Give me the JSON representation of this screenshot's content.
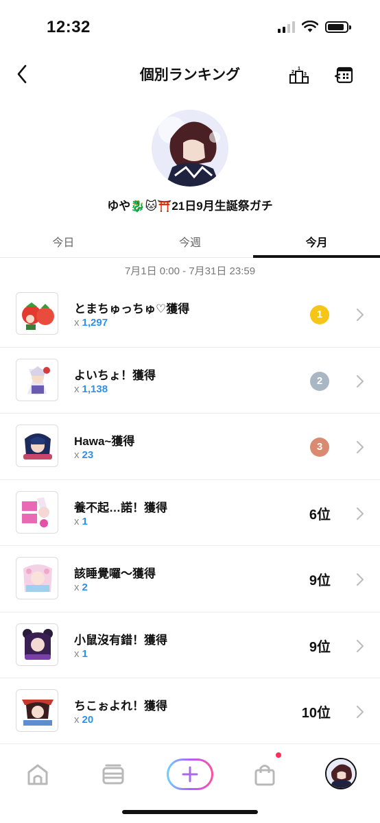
{
  "status_bar": {
    "time": "12:32"
  },
  "header": {
    "title": "個別ランキング"
  },
  "profile": {
    "username": "ゆや🐉🐱⛩️21日9月生誕祭ガチ"
  },
  "tabs": [
    {
      "label": "今日",
      "active": false
    },
    {
      "label": "今週",
      "active": false
    },
    {
      "label": "今月",
      "active": true
    }
  ],
  "period": "7月1日 0:00 - 7月31日 23:59",
  "items": [
    {
      "name": "とまちゅっちゅ♡獲得",
      "count_prefix": "x",
      "count": "1,297",
      "rank": "1",
      "medal_color": "#f5c518"
    },
    {
      "name": "よいちょ！獲得",
      "count_prefix": "x",
      "count": "1,138",
      "rank": "2",
      "medal_color": "#a9b7c4"
    },
    {
      "name": "Hawa~獲得",
      "count_prefix": "x",
      "count": "23",
      "rank": "3",
      "medal_color": "#d98a70"
    },
    {
      "name": "養不起…諾！獲得",
      "count_prefix": "x",
      "count": "1",
      "rank": "6位"
    },
    {
      "name": "該睡覺囉～獲得",
      "count_prefix": "x",
      "count": "2",
      "rank": "9位"
    },
    {
      "name": "小鼠沒有錯！獲得",
      "count_prefix": "x",
      "count": "1",
      "rank": "9位"
    },
    {
      "name": "ちこぉよれ！獲得",
      "count_prefix": "x",
      "count": "20",
      "rank": "10位"
    }
  ],
  "icons": {
    "back": "chevron-left-icon",
    "podium": "podium-icon",
    "calendar": "calendar-back-icon",
    "nav": [
      "home-icon",
      "wallet-icon",
      "plus-icon",
      "shopping-bag-icon",
      "profile-avatar"
    ]
  },
  "colors": {
    "count_blue": "#2f8fe6",
    "notification_red": "#ff2f55"
  }
}
